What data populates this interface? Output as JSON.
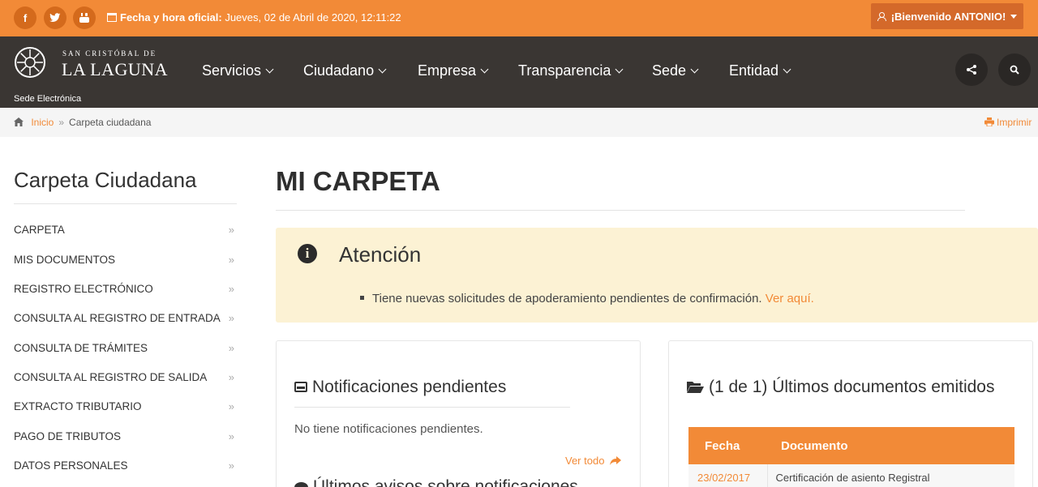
{
  "topbar": {
    "social": [
      {
        "name": "facebook-icon",
        "glyph": "f"
      },
      {
        "name": "twitter-icon",
        "glyph": "t"
      },
      {
        "name": "youtube-icon",
        "glyph": "▶"
      }
    ],
    "date_label": "Fecha y hora oficial:",
    "date_value": "Jueves, 02 de Abril de 2020, 12:11:22",
    "welcome": "¡Bienvenido ANTONIO!"
  },
  "brand": {
    "line1": "SAN CRISTÓBAL DE",
    "line2": "LA LAGUNA",
    "subtitle": "Sede Electrónica"
  },
  "nav": {
    "items": [
      "Servicios",
      "Ciudadano",
      "Empresa",
      "Transparencia",
      "Sede",
      "Entidad"
    ]
  },
  "breadcrumb": {
    "home": "Inicio",
    "separator": "»",
    "current": "Carpeta ciudadana",
    "print": "Imprimir"
  },
  "sidebar": {
    "title": "Carpeta Ciudadana",
    "items": [
      "CARPETA",
      "MIS DOCUMENTOS",
      "REGISTRO ELECTRÓNICO",
      "CONSULTA AL REGISTRO DE ENTRADA",
      "CONSULTA DE TRÁMITES",
      "CONSULTA AL REGISTRO DE SALIDA",
      "EXTRACTO TRIBUTARIO",
      "PAGO DE TRIBUTOS",
      "DATOS PERSONALES"
    ],
    "arrow": "»"
  },
  "main": {
    "title": "MI CARPETA",
    "alert": {
      "title": "Atención",
      "message": "Tiene nuevas solicitudes de apoderamiento pendientes de confirmación.",
      "link": "Ver aquí."
    },
    "notifications": {
      "title": "Notificaciones pendientes",
      "empty": "No tiene notificaciones pendientes.",
      "see_all": "Ver todo",
      "next_section": "Últimos avisos sobre notificaciones"
    },
    "documents": {
      "title": "(1 de 1) Últimos documentos emitidos",
      "headers": [
        "Fecha",
        "Documento"
      ],
      "rows": [
        {
          "date": "23/02/2017",
          "name": "Certificación de asiento Registral"
        }
      ]
    }
  },
  "colors": {
    "accent": "#f28a37",
    "nav_bg": "#3a3633",
    "alert_bg": "#fcf2d4"
  }
}
